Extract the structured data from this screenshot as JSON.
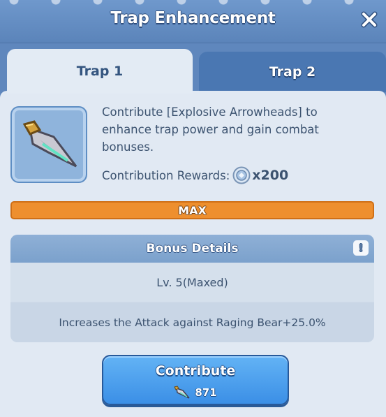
{
  "window": {
    "title": "Trap Enhancement",
    "close_icon": "close-icon"
  },
  "tabs": [
    {
      "label": "Trap 1",
      "active": true
    },
    {
      "label": "Trap 2",
      "active": false
    }
  ],
  "item": {
    "icon": "arrowhead-icon",
    "description": "Contribute [Explosive Arrowheads] to enhance trap power and gain combat bonuses.",
    "rewards_label": "Contribution Rewards:",
    "rewards_icon": "coin-icon",
    "rewards_quantity": "x200"
  },
  "progress": {
    "label": "MAX",
    "fraction": 1.0,
    "color": "#ee8f2e"
  },
  "bonus": {
    "title": "Bonus Details",
    "info_icon": "info-icon",
    "level": "Lv. 5(Maxed)",
    "effect": "Increases the Attack against Raging Bear+25.0%"
  },
  "contribute": {
    "label": "Contribute",
    "cost_icon": "arrowhead-icon",
    "cost": "871"
  },
  "colors": {
    "accent": "#3b8fe6",
    "header": "#5f87bd",
    "panel": "#e1e9f3",
    "text": "#3c5370"
  }
}
